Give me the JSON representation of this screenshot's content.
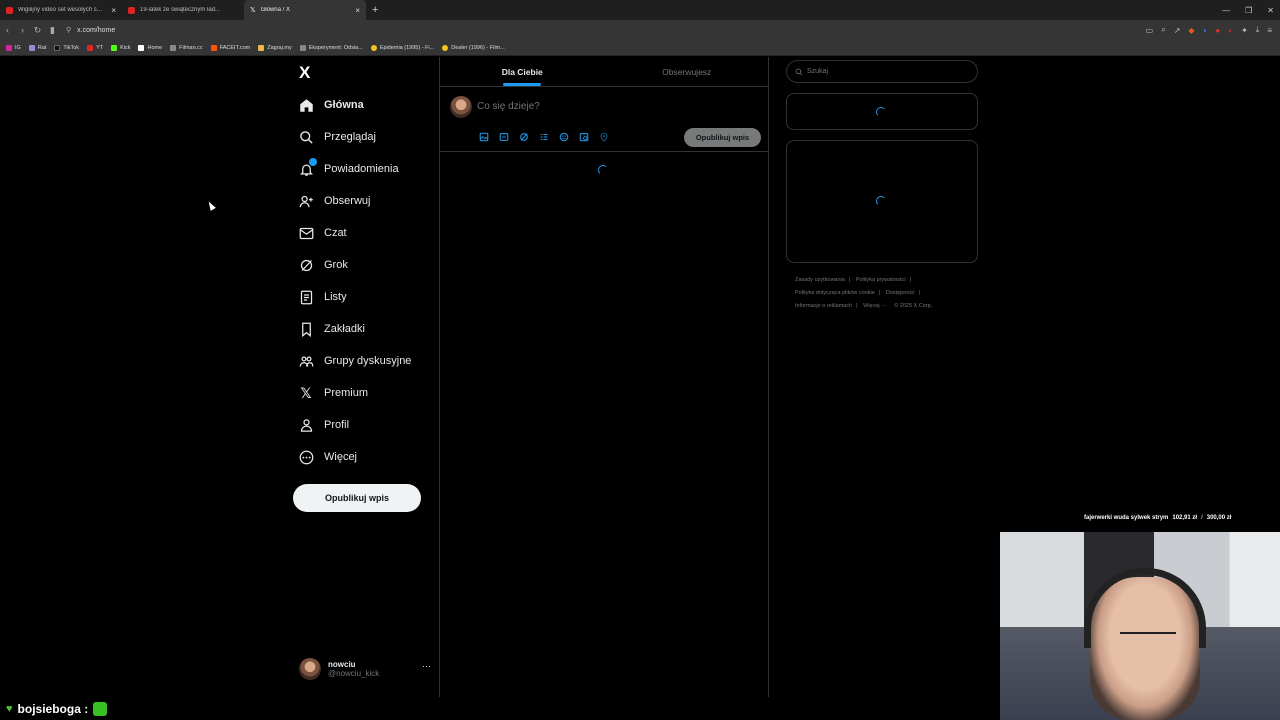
{
  "browser": {
    "tabs": [
      {
        "title": "Wigilijny video set wesołych świąt ka",
        "favicon": "youtube-icon",
        "active": false
      },
      {
        "title": "19-latek ze świątecznym ład...",
        "favicon": "youtube-icon",
        "active": false
      },
      {
        "title": "Główna / X",
        "favicon": "x-logo-icon",
        "active": true
      }
    ],
    "url": "x.com/home",
    "bookmarks": [
      "IG",
      "Rat",
      "TikTok",
      "YT",
      "Kick",
      "Home",
      "Filman.cc",
      "FACEIT.com",
      "Zagraj.my",
      "Eksperyment: Odsia...",
      "Epidemia (1995) - Fi...",
      "Dealer (1996) - Film..."
    ]
  },
  "sidebar": {
    "logo": "X",
    "items": [
      {
        "label": "Główna",
        "icon": "home-icon",
        "active": true
      },
      {
        "label": "Przeglądaj",
        "icon": "search-icon"
      },
      {
        "label": "Powiadomienia",
        "icon": "bell-icon"
      },
      {
        "label": "Obserwuj",
        "icon": "follow-icon"
      },
      {
        "label": "Czat",
        "icon": "mail-icon"
      },
      {
        "label": "Grok",
        "icon": "grok-icon"
      },
      {
        "label": "Listy",
        "icon": "list-icon"
      },
      {
        "label": "Zakładki",
        "icon": "bookmark-icon"
      },
      {
        "label": "Grupy dyskusyjne",
        "icon": "communities-icon"
      },
      {
        "label": "Premium",
        "icon": "x-icon"
      },
      {
        "label": "Profil",
        "icon": "profile-icon"
      },
      {
        "label": "Więcej",
        "icon": "more-icon"
      }
    ],
    "post_button": "Opublikuj wpis",
    "account": {
      "name": "nowciu",
      "handle": "@nowciu_kick"
    }
  },
  "main": {
    "tabs": [
      {
        "label": "Dla Ciebie",
        "active": true
      },
      {
        "label": "Obserwujesz",
        "active": false
      }
    ],
    "compose_placeholder": "Co się dzieje?",
    "compose_button": "Opublikuj wpis",
    "compose_tools": [
      "image-icon",
      "gif-icon",
      "grok-icon",
      "poll-icon",
      "emoji-icon",
      "schedule-icon",
      "location-icon"
    ]
  },
  "right": {
    "search_placeholder": "Szukaj",
    "footer_links": [
      "Zasady użytkowania",
      "Polityka prywatności",
      "Polityka dotycząca plików cookie",
      "Dostępność",
      "Informacje o reklamach",
      "Więcej ···",
      "© 2025 X Corp."
    ]
  },
  "stream": {
    "donation": {
      "text": "fajerwerki wuda sylwek strym",
      "current": "102,91 zł",
      "target": "300,00 zł"
    },
    "chat_user": "bojsieboga :"
  },
  "colors": {
    "accent": "#1d9bf0",
    "background": "#000000",
    "border": "#2f3336",
    "muted": "#71767b"
  }
}
